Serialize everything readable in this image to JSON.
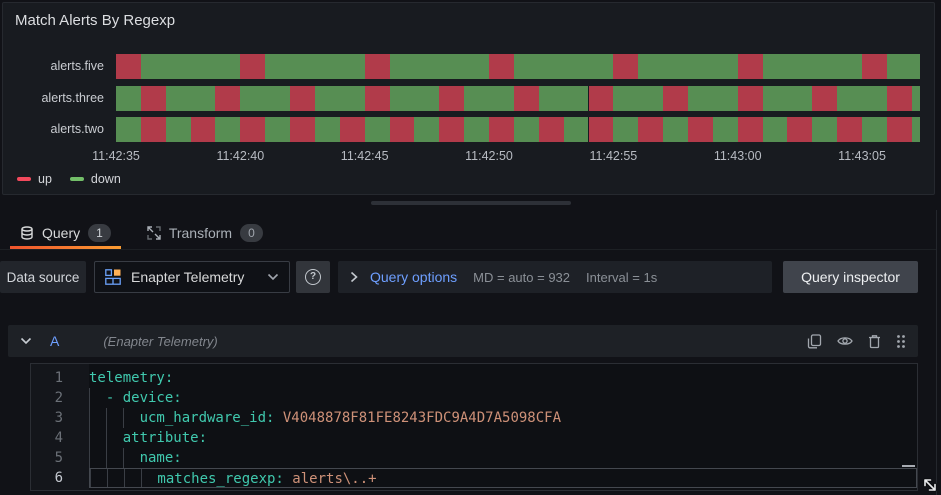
{
  "panel": {
    "title": "Match Alerts By Regexp",
    "legend": [
      {
        "label": "up",
        "color": "#f2495c"
      },
      {
        "label": "down",
        "color": "#73bf69"
      }
    ]
  },
  "chart_data": {
    "type": "state-timeline",
    "x_start": 35,
    "x_end": 67.33,
    "x_unit": "seconds after 11:42:00",
    "ticks": [
      {
        "t": 35,
        "label": "11:42:35"
      },
      {
        "t": 40,
        "label": "11:42:40"
      },
      {
        "t": 45,
        "label": "11:42:45"
      },
      {
        "t": 50,
        "label": "11:42:50"
      },
      {
        "t": 55,
        "label": "11:42:55"
      },
      {
        "t": 60,
        "label": "11:43:00"
      },
      {
        "t": 65,
        "label": "11:43:05"
      }
    ],
    "state_colors": {
      "up": "#b13b4a",
      "down": "#578e53"
    },
    "legend_colors": {
      "up": "#f2495c",
      "down": "#73bf69"
    },
    "series": [
      {
        "name": "alerts.five",
        "segments": [
          [
            35,
            36,
            "up"
          ],
          [
            36,
            40,
            "down"
          ],
          [
            40,
            41,
            "up"
          ],
          [
            41,
            45,
            "down"
          ],
          [
            45,
            46,
            "up"
          ],
          [
            46,
            50,
            "down"
          ],
          [
            50,
            51,
            "up"
          ],
          [
            51,
            55,
            "down"
          ],
          [
            55,
            56,
            "up"
          ],
          [
            56,
            60,
            "down"
          ],
          [
            60,
            61,
            "up"
          ],
          [
            61,
            65,
            "down"
          ],
          [
            65,
            66,
            "up"
          ],
          [
            66,
            67.33,
            "down"
          ]
        ]
      },
      {
        "name": "alerts.three",
        "segments": [
          [
            35,
            36,
            "down"
          ],
          [
            36,
            37,
            "up"
          ],
          [
            37,
            39,
            "down"
          ],
          [
            39,
            40,
            "up"
          ],
          [
            40,
            42,
            "down"
          ],
          [
            42,
            43,
            "up"
          ],
          [
            43,
            45,
            "down"
          ],
          [
            45,
            46,
            "up"
          ],
          [
            46,
            48,
            "down"
          ],
          [
            48,
            49,
            "up"
          ],
          [
            49,
            51,
            "down"
          ],
          [
            51,
            52,
            "up"
          ],
          [
            52,
            54,
            "down"
          ],
          [
            54,
            55,
            "up"
          ],
          [
            55,
            57,
            "down"
          ],
          [
            57,
            58,
            "up"
          ],
          [
            58,
            60,
            "down"
          ],
          [
            60,
            61,
            "up"
          ],
          [
            61,
            63,
            "down"
          ],
          [
            63,
            64,
            "up"
          ],
          [
            64,
            66,
            "down"
          ],
          [
            66,
            67,
            "up"
          ],
          [
            67,
            67.33,
            "down"
          ]
        ]
      },
      {
        "name": "alerts.two",
        "segments": [
          [
            35,
            36,
            "down"
          ],
          [
            36,
            37,
            "up"
          ],
          [
            37,
            38,
            "down"
          ],
          [
            38,
            39,
            "up"
          ],
          [
            39,
            40,
            "down"
          ],
          [
            40,
            41,
            "up"
          ],
          [
            41,
            42,
            "down"
          ],
          [
            42,
            43,
            "up"
          ],
          [
            43,
            44,
            "down"
          ],
          [
            44,
            45,
            "up"
          ],
          [
            45,
            46,
            "down"
          ],
          [
            46,
            47,
            "up"
          ],
          [
            47,
            48,
            "down"
          ],
          [
            48,
            49,
            "up"
          ],
          [
            49,
            50,
            "down"
          ],
          [
            50,
            51,
            "up"
          ],
          [
            51,
            52,
            "down"
          ],
          [
            52,
            53,
            "up"
          ],
          [
            53,
            54,
            "down"
          ],
          [
            54,
            55,
            "up"
          ],
          [
            55,
            56,
            "down"
          ],
          [
            56,
            57,
            "up"
          ],
          [
            57,
            58,
            "down"
          ],
          [
            58,
            59,
            "up"
          ],
          [
            59,
            60,
            "down"
          ],
          [
            60,
            61,
            "up"
          ],
          [
            61,
            62,
            "down"
          ],
          [
            62,
            63,
            "up"
          ],
          [
            63,
            64,
            "down"
          ],
          [
            64,
            65,
            "up"
          ],
          [
            65,
            66,
            "down"
          ],
          [
            66,
            67,
            "up"
          ],
          [
            67,
            67.33,
            "down"
          ]
        ]
      }
    ]
  },
  "tabs": {
    "query": {
      "label": "Query",
      "count": "1"
    },
    "transform": {
      "label": "Transform",
      "count": "0"
    }
  },
  "datasource_row": {
    "label": "Data source",
    "picker_value": "Enapter Telemetry",
    "help_glyph": "?",
    "query_options_label": "Query options",
    "meta": [
      "MD = auto = 932",
      "Interval = 1s"
    ],
    "inspector_label": "Query inspector"
  },
  "query_row": {
    "ref_id": "A",
    "datasource_hint": "(Enapter Telemetry)"
  },
  "code": {
    "lines": [
      {
        "n": "1",
        "guides": [],
        "tokens": [
          {
            "t": "telemetry:",
            "c": "key"
          }
        ],
        "active": false
      },
      {
        "n": "2",
        "guides": [
          0
        ],
        "tokens": [
          {
            "t": "  - device:",
            "c": "key"
          }
        ],
        "active": false
      },
      {
        "n": "3",
        "guides": [
          0,
          2,
          4
        ],
        "tokens": [
          {
            "t": "      ucm_hardware_id: ",
            "c": "key"
          },
          {
            "t": "V4048878F81FE8243FDC9A4D7A5098CFA",
            "c": "str"
          }
        ],
        "active": false
      },
      {
        "n": "4",
        "guides": [
          0,
          2
        ],
        "tokens": [
          {
            "t": "    attribute:",
            "c": "key"
          }
        ],
        "active": false
      },
      {
        "n": "5",
        "guides": [
          0,
          2,
          4
        ],
        "tokens": [
          {
            "t": "      name:",
            "c": "key"
          }
        ],
        "active": false
      },
      {
        "n": "6",
        "guides": [
          0,
          2,
          4,
          6
        ],
        "tokens": [
          {
            "t": "        matches_regexp: ",
            "c": "key"
          },
          {
            "t": "alerts\\..+",
            "c": "str"
          }
        ],
        "active": true
      }
    ]
  },
  "colors": {
    "accent_blue": "#6e9fff",
    "tab_underline_from": "#f0542d",
    "tab_underline_to": "#fb9d32",
    "key_teal": "#40c9ae",
    "value_orange": "#ce9178"
  }
}
